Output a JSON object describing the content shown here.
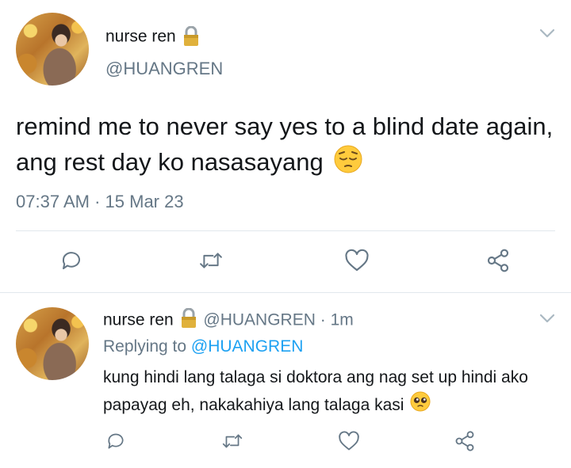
{
  "main_tweet": {
    "display_name": "nurse ren",
    "handle": "@HUANGREN",
    "text": "remind me to never say yes to a blind date again, ang rest day ko nasasayang",
    "time": "07:37 AM",
    "separator": "·",
    "date": "15 Mar 23"
  },
  "reply_tweet": {
    "display_name": "nurse ren",
    "handle": "@HUANGREN",
    "separator": "·",
    "age": "1m",
    "replying_prefix": "Replying to",
    "replying_handle": "@HUANGREN",
    "text": "kung hindi lang talaga si doktora ang nag set up hindi ako papayag eh, nakakahiya lang talaga kasi"
  },
  "icons": {
    "lock": "lock-icon",
    "chevron": "chevron-down-icon",
    "reply": "reply-icon",
    "retweet": "retweet-icon",
    "like": "heart-icon",
    "share": "share-icon",
    "emoji_pensive": "pensive-face-emoji",
    "emoji_pleading": "pleading-face-emoji"
  },
  "colors": {
    "text": "#14171a",
    "secondary": "#657786",
    "link": "#1da1f2",
    "divider": "#e1e8ed"
  }
}
